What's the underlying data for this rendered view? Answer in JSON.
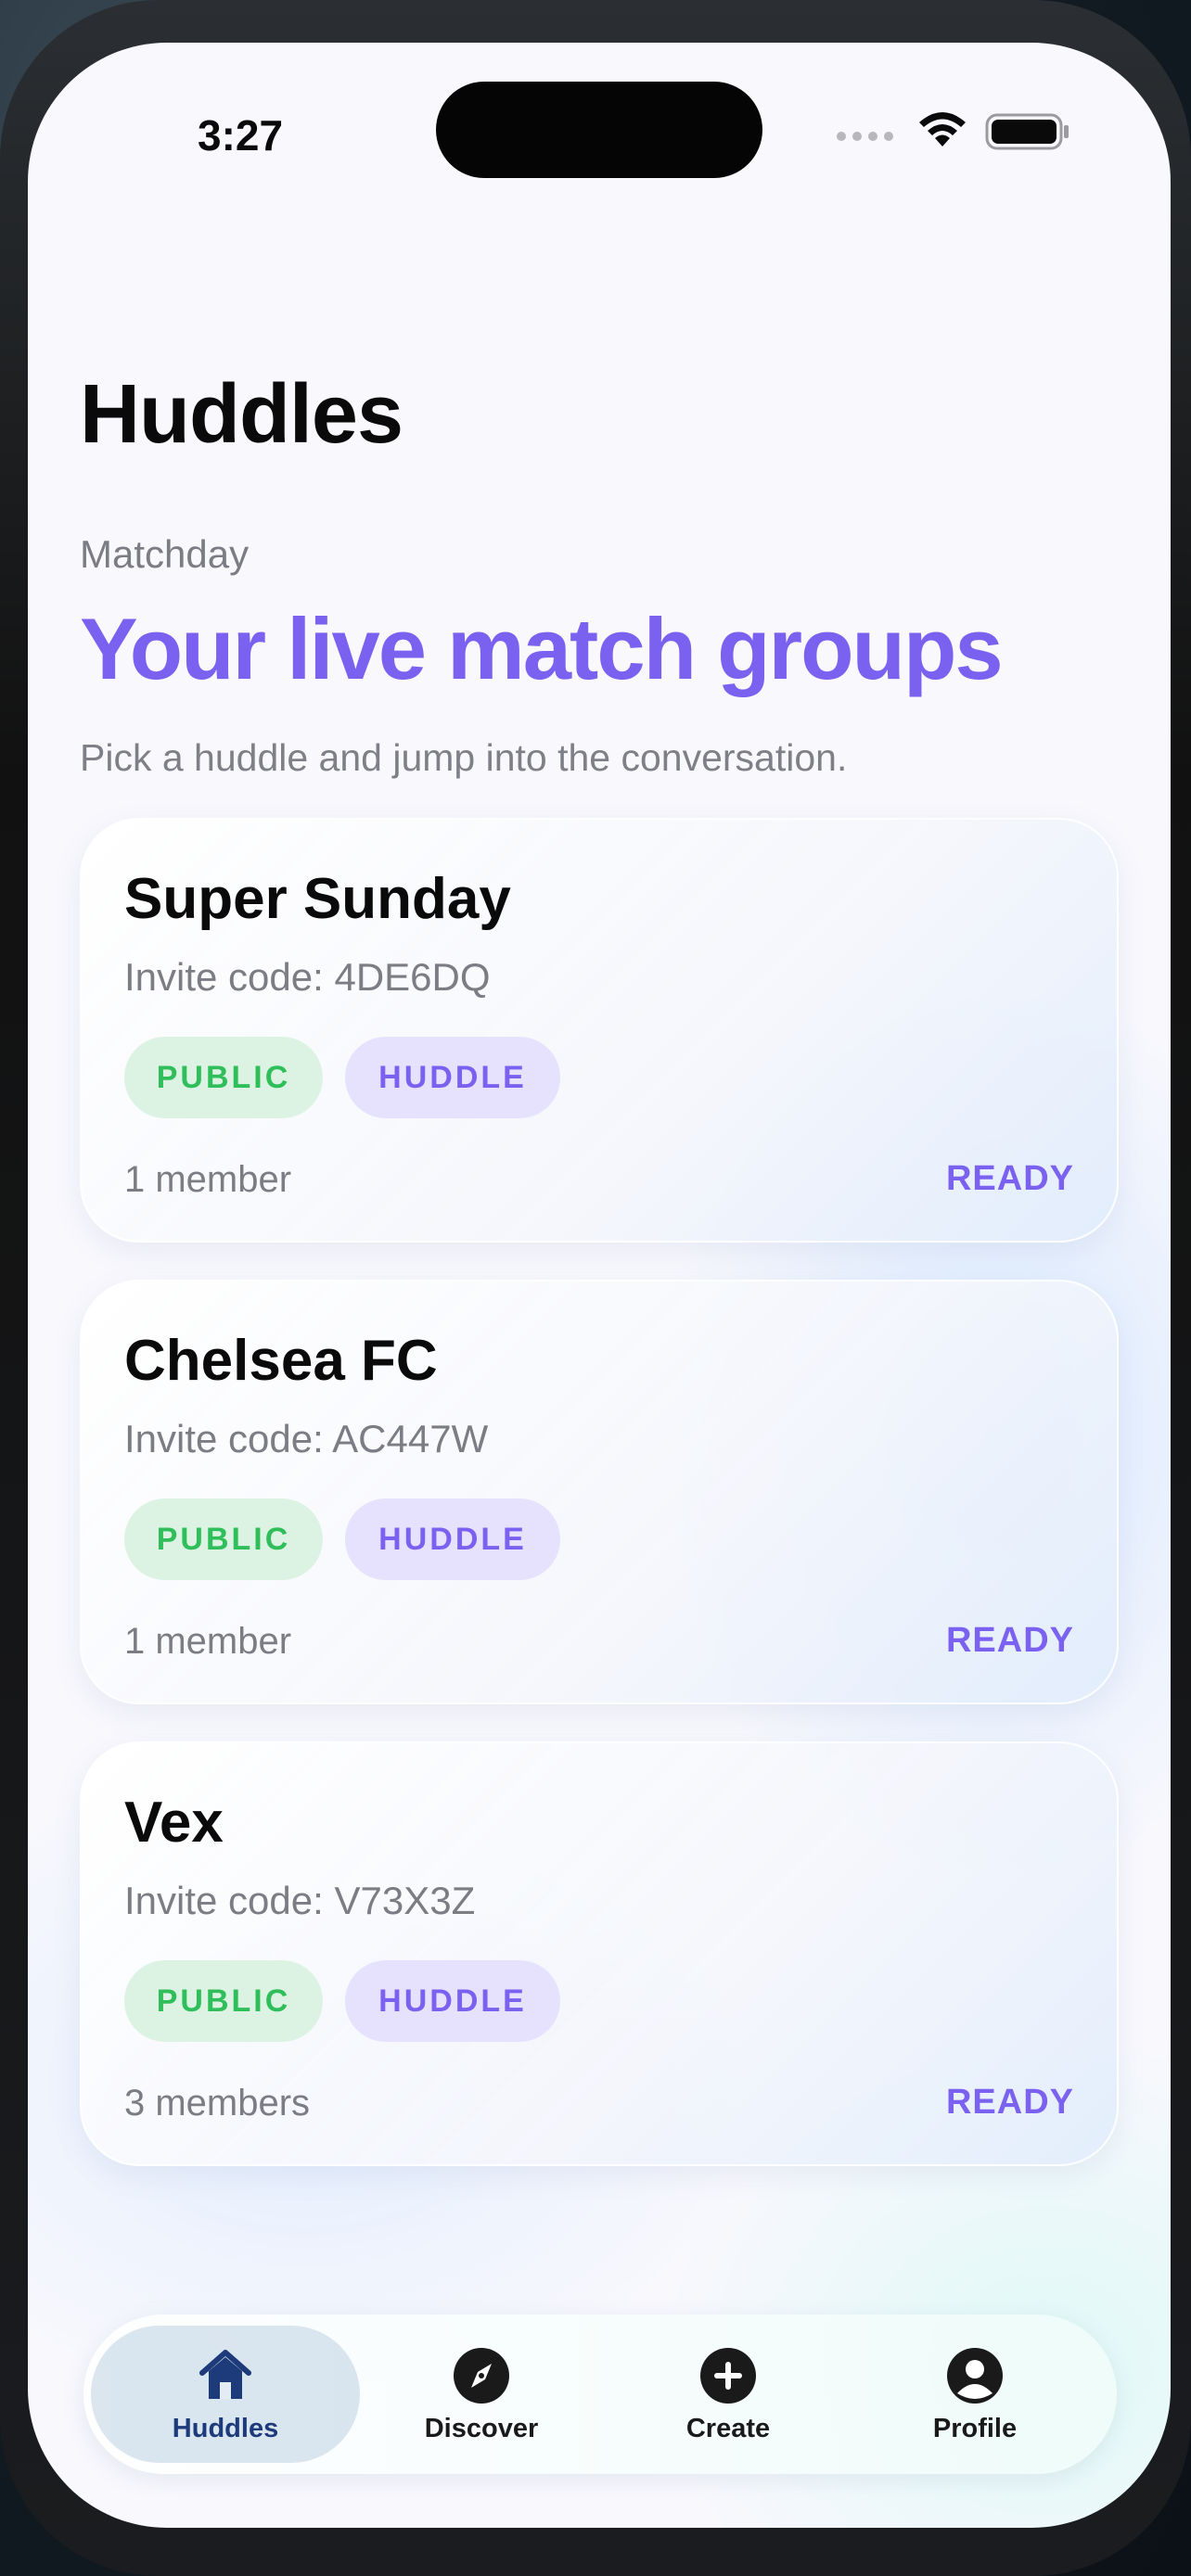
{
  "status_bar": {
    "time": "3:27"
  },
  "header": {
    "title": "Huddles",
    "eyebrow": "Matchday",
    "headline": "Your live match groups",
    "subtitle": "Pick a huddle and jump into the conversation."
  },
  "huddles": [
    {
      "name": "Super Sunday",
      "invite": "Invite code: 4DE6DQ",
      "tag_visibility": "PUBLIC",
      "tag_type": "HUDDLE",
      "members": "1 member",
      "status": "READY"
    },
    {
      "name": "Chelsea FC",
      "invite": "Invite code: AC447W",
      "tag_visibility": "PUBLIC",
      "tag_type": "HUDDLE",
      "members": "1 member",
      "status": "READY"
    },
    {
      "name": "Vex",
      "invite": "Invite code: V73X3Z",
      "tag_visibility": "PUBLIC",
      "tag_type": "HUDDLE",
      "members": "3 members",
      "status": "READY"
    }
  ],
  "tabbar": {
    "items": [
      {
        "label": "Huddles",
        "icon": "home-icon",
        "active": true
      },
      {
        "label": "Discover",
        "icon": "compass-icon",
        "active": false
      },
      {
        "label": "Create",
        "icon": "plus-circle-icon",
        "active": false
      },
      {
        "label": "Profile",
        "icon": "profile-icon",
        "active": false
      }
    ]
  },
  "colors": {
    "accent": "#7b61f0",
    "public_green": "#2fbe5a",
    "active_tab": "#1d3a7a"
  }
}
